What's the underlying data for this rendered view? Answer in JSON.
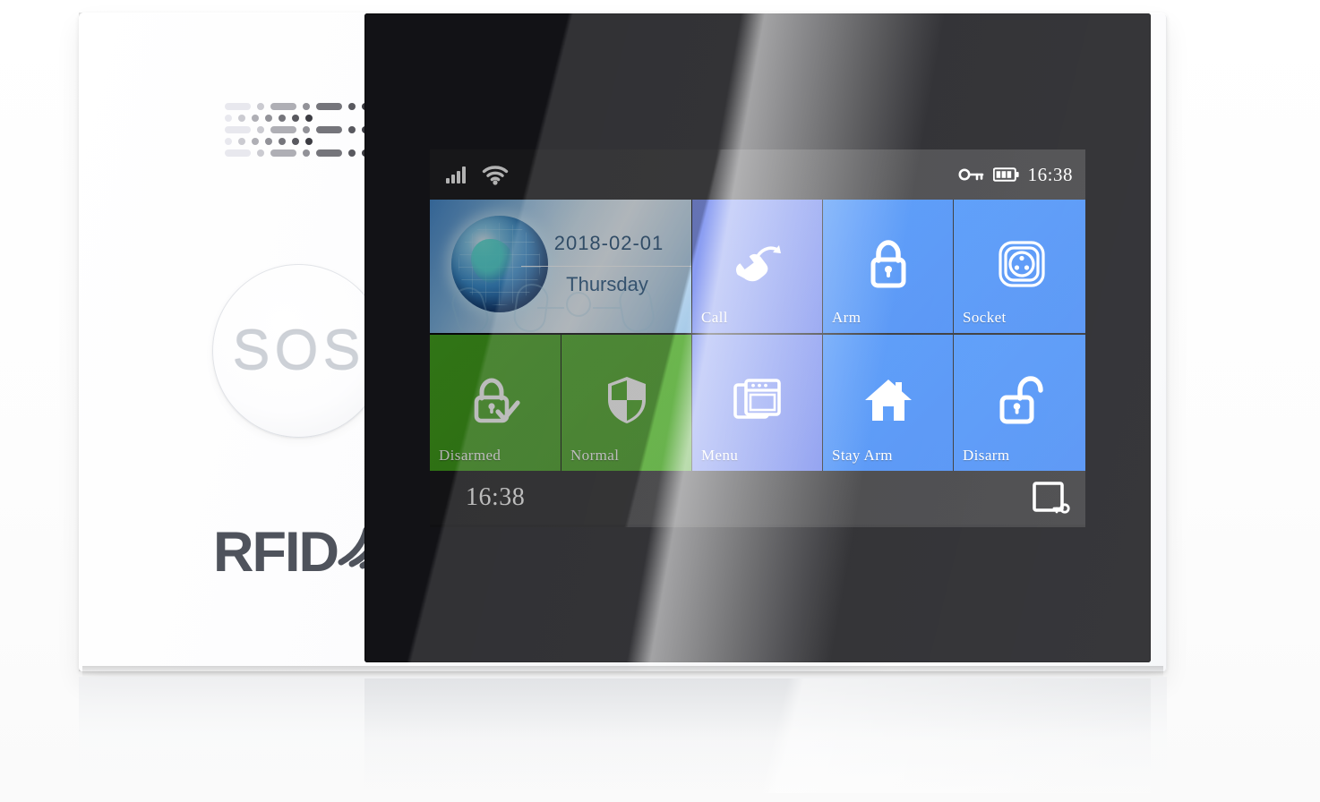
{
  "device": {
    "sos_label": "SOS",
    "brand_label": "RFID",
    "speaker_grille_name": "speaker-grille"
  },
  "screen": {
    "status_bar": {
      "signal_icon": "signal-bars-icon",
      "wifi_icon": "wifi-icon",
      "key_icon": "key-icon",
      "battery_icon": "battery-icon",
      "time": "16:38"
    },
    "widget": {
      "globe_icon": "globe-icon",
      "date": "2018-02-01",
      "weekday": "Thursday"
    },
    "tiles": [
      {
        "label": "Call",
        "icon": "call-forward-icon",
        "color": "#6a82ee",
        "row": 1
      },
      {
        "label": "Arm",
        "icon": "lock-closed-icon",
        "color": "#2e7ef7",
        "row": 1
      },
      {
        "label": "Socket",
        "icon": "power-socket-icon",
        "color": "#2e7ef7",
        "row": 1
      },
      {
        "label": "Disarmed",
        "icon": "lock-check-icon",
        "color": "#44a51e",
        "row": 2
      },
      {
        "label": "Normal",
        "icon": "shield-icon",
        "color": "#44a51e",
        "row": 2
      },
      {
        "label": "Menu",
        "icon": "windows-menu-icon",
        "color": "#6a82ee",
        "row": 2
      },
      {
        "label": "Stay Arm",
        "icon": "home-icon",
        "color": "#2e7ef7",
        "row": 2
      },
      {
        "label": "Disarm",
        "icon": "lock-open-icon",
        "color": "#2e7ef7",
        "row": 2
      }
    ],
    "bottom_bar": {
      "time": "16:38",
      "unlock_icon": "screen-key-icon"
    }
  },
  "colors": {
    "tile_blue": "#2e7ef7",
    "tile_purple": "#6a82ee",
    "tile_green": "#44a51e",
    "bezel": "#121216",
    "status_bar": "#212124",
    "bottom_bar": "#1b1b1e",
    "body_white": "#ffffff",
    "brand_gray": "#4f535c"
  }
}
